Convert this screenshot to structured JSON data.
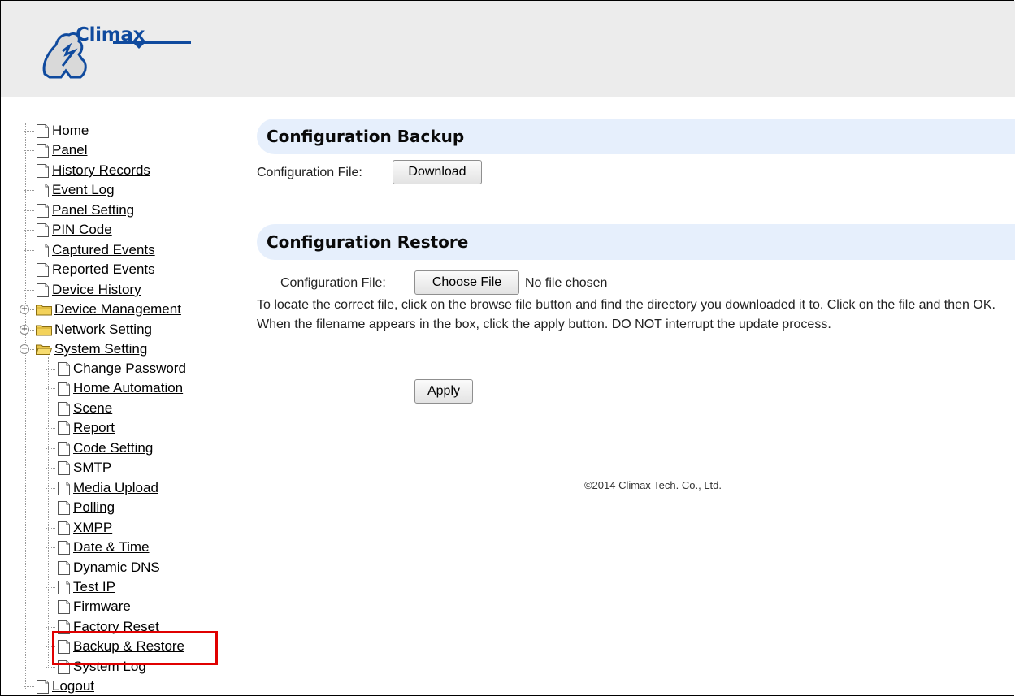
{
  "brand": {
    "logo_text": "Climax"
  },
  "nav": {
    "items": [
      {
        "label": "Home",
        "kind": "page"
      },
      {
        "label": "Panel",
        "kind": "page"
      },
      {
        "label": "History Records",
        "kind": "page"
      },
      {
        "label": "Event Log",
        "kind": "page"
      },
      {
        "label": "Panel Setting",
        "kind": "page"
      },
      {
        "label": "PIN Code",
        "kind": "page"
      },
      {
        "label": "Captured Events",
        "kind": "page"
      },
      {
        "label": "Reported Events",
        "kind": "page"
      },
      {
        "label": "Device History",
        "kind": "page"
      },
      {
        "label": "Device Management",
        "kind": "folder",
        "expanded": false
      },
      {
        "label": "Network Setting",
        "kind": "folder",
        "expanded": false
      },
      {
        "label": "System Setting",
        "kind": "folder",
        "expanded": true
      }
    ],
    "system_children": [
      "Change Password",
      "Home Automation",
      "Scene",
      "Report",
      "Code Setting",
      "SMTP",
      "Media Upload",
      "Polling",
      "XMPP",
      "Date & Time",
      "Dynamic DNS",
      "Test IP",
      "Firmware",
      "Factory Reset",
      "Backup & Restore",
      "System Log"
    ],
    "logout": "Logout",
    "selected": "Backup & Restore",
    "highlight_color": "#e00000"
  },
  "backup": {
    "title": "Configuration Backup",
    "file_label": "Configuration File:",
    "download_button": "Download"
  },
  "restore": {
    "title": "Configuration Restore",
    "file_label": "Configuration File:",
    "choose_button": "Choose File",
    "no_file": "No file chosen",
    "instructions": "To locate the correct file, click on the browse file button and find the directory you downloaded it to. Click on the file and then OK. When the filename appears in the box, click the apply button. DO NOT interrupt the update process.",
    "apply_button": "Apply"
  },
  "footer": {
    "copyright": "©2014 Climax Tech. Co., Ltd."
  },
  "colors": {
    "section_bg": "#e6effc",
    "header_bg": "#ececec",
    "brand_blue": "#0f4a9e"
  }
}
